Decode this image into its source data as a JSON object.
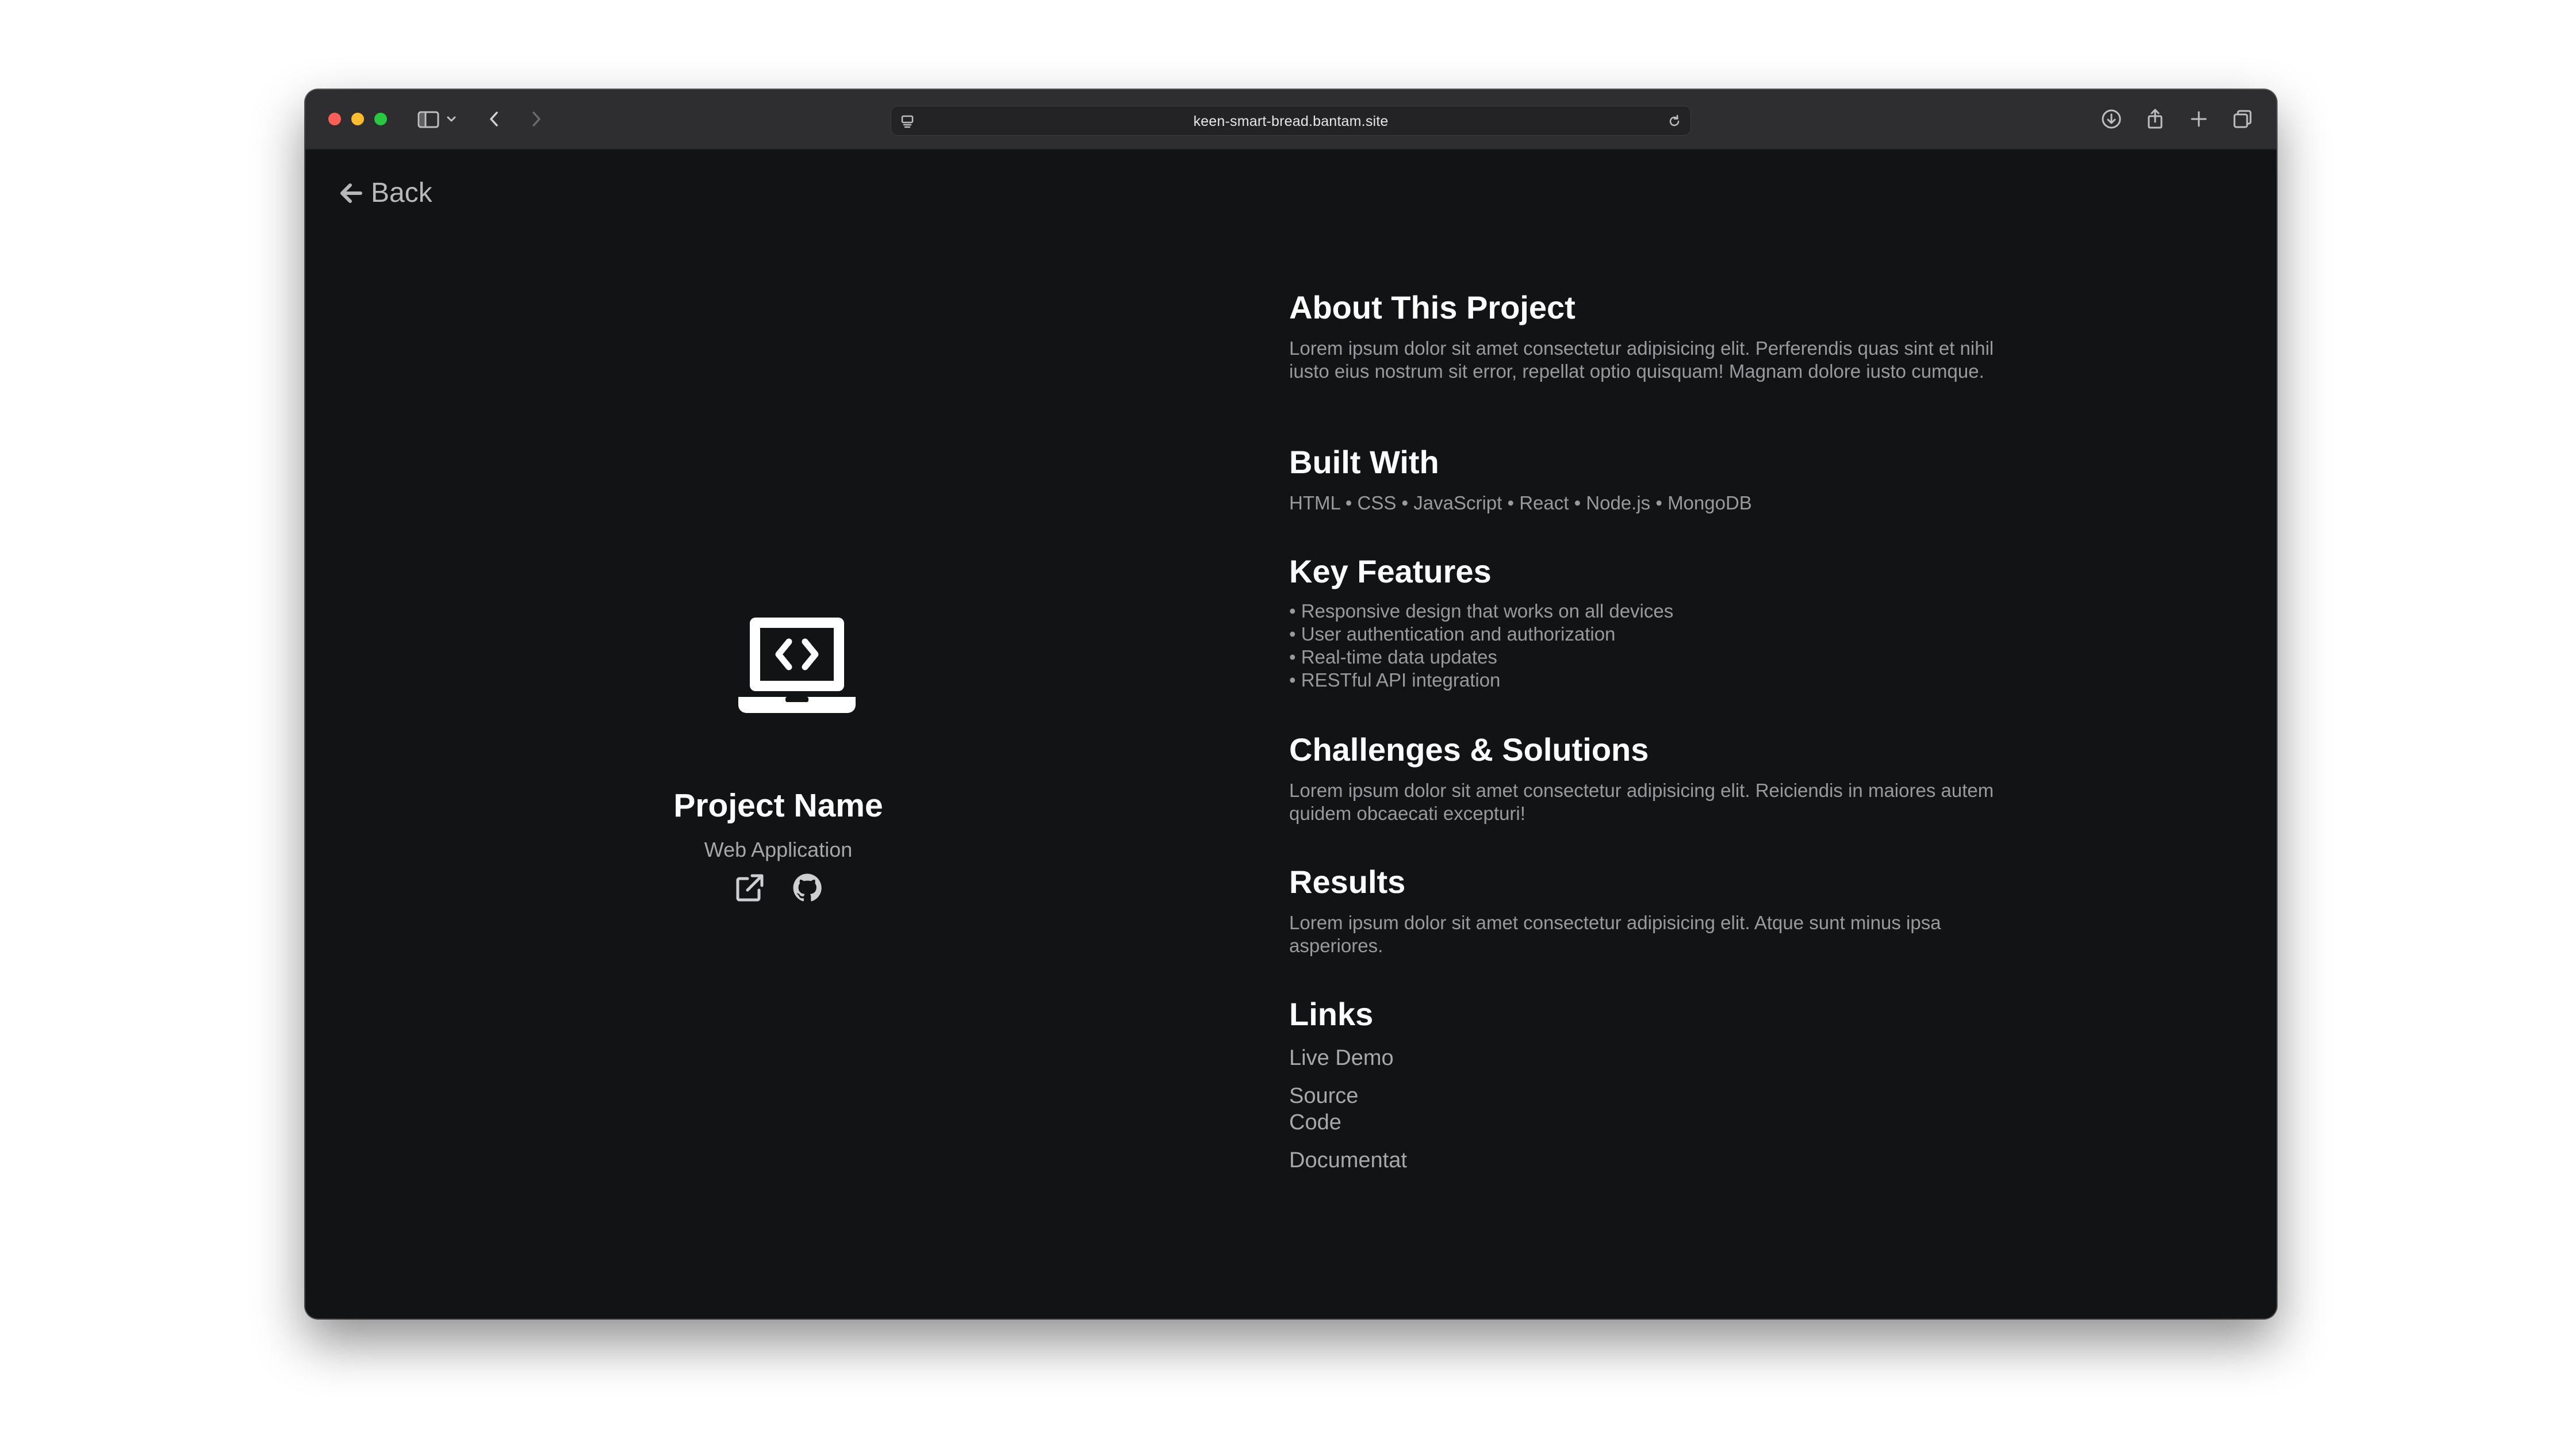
{
  "browser": {
    "url": "keen-smart-bread.bantam.site"
  },
  "nav": {
    "back_label": "Back"
  },
  "project": {
    "name": "Project Name",
    "type": "Web Application"
  },
  "sections": {
    "about": {
      "heading": "About This Project",
      "text": "Lorem ipsum dolor sit amet consectetur adipisicing elit. Perferendis quas sint et nihil iusto eius nostrum sit error, repellat optio quisquam! Magnam dolore iusto cumque."
    },
    "built_with": {
      "heading": "Built With",
      "text": "HTML • CSS • JavaScript • React • Node.js • MongoDB"
    },
    "features": {
      "heading": "Key Features",
      "items": [
        "• Responsive design that works on all devices",
        "• User authentication and authorization",
        "• Real-time data updates",
        "• RESTful API integration"
      ]
    },
    "challenges": {
      "heading": "Challenges & Solutions",
      "text": "Lorem ipsum dolor sit amet consectetur adipisicing elit. Reiciendis in maiores autem quidem obcaecati excepturi!"
    },
    "results": {
      "heading": "Results",
      "text": "Lorem ipsum dolor sit amet consectetur adipisicing elit. Atque sunt minus ipsa asperiores."
    },
    "links": {
      "heading": "Links",
      "items": [
        "Live Demo",
        "Source Code",
        "Documentat"
      ]
    }
  },
  "icons": {
    "hero": "laptop-code-icon",
    "external": "external-link-icon",
    "github": "github-icon"
  }
}
